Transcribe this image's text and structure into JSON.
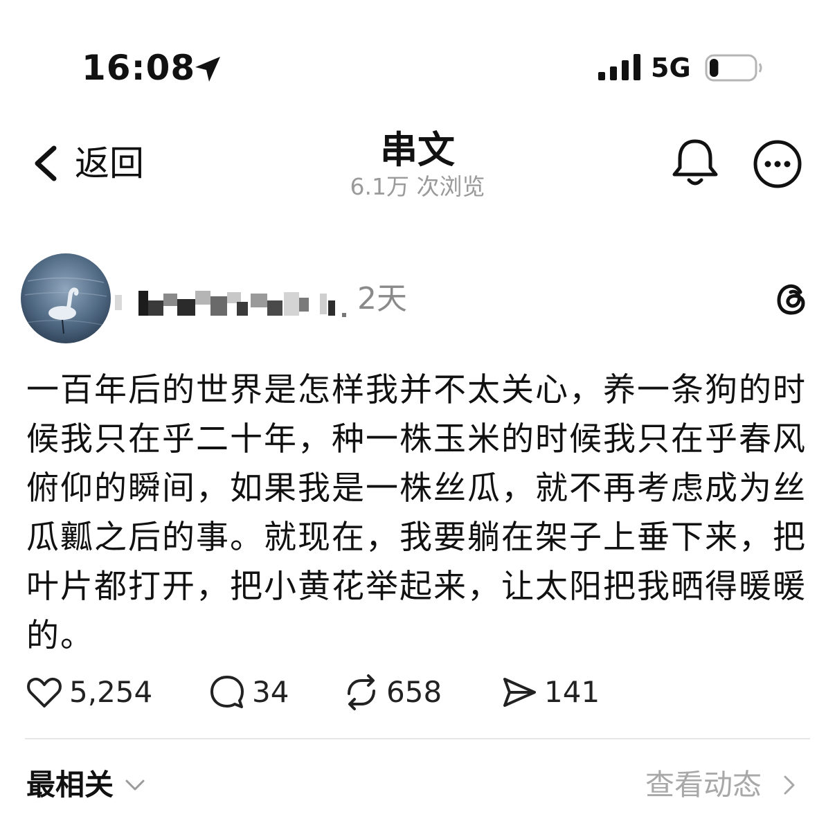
{
  "status_bar": {
    "time": "16:08",
    "network": "5G",
    "location_icon": "location-arrow-icon",
    "signal_icon": "cellular-signal-icon",
    "battery_icon": "battery-icon",
    "battery_level_fraction": 0.2
  },
  "nav": {
    "back_label": "返回",
    "title": "串文",
    "views": "6.1万 次浏览",
    "bell_icon": "bell-icon",
    "more_icon": "more-icon"
  },
  "post": {
    "time_ago": "2天",
    "text": "一百年后的世界是怎样我并不太关心，养一条狗的时候我只在乎二十年，种一株玉米的时候我只在乎春风俯仰的瞬间，如果我是一株丝瓜，就不再考虑成为丝瓜瓤之后的事。就现在，我要躺在架子上垂下来，把叶片都打开，把小黄花举起来，让太阳把我晒得暖暖的。",
    "actions": {
      "likes": "5,254",
      "comments": "34",
      "reposts": "658",
      "shares": "141"
    }
  },
  "footer": {
    "sort_label": "最相关",
    "activity_label": "查看动态"
  },
  "colors": {
    "text": "#111111",
    "muted": "#9a9a9a",
    "divider": "#e6e6e6"
  }
}
